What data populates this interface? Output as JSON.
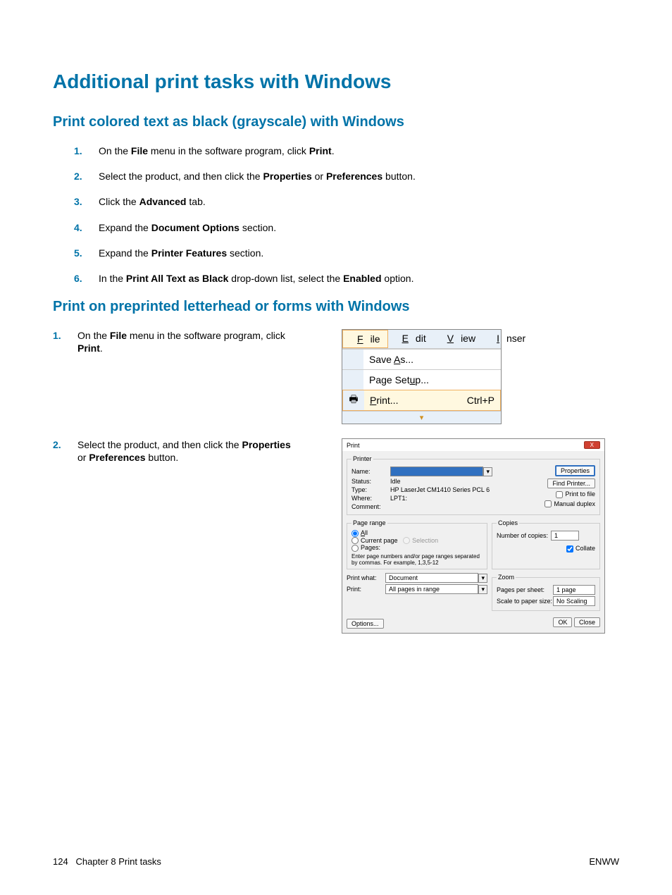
{
  "title": "Additional print tasks with Windows",
  "section1": {
    "heading": "Print colored text as black (grayscale) with Windows",
    "steps": [
      {
        "pre": "On the ",
        "b1": "File",
        "mid1": " menu in the software program, click ",
        "b2": "Print",
        "post": "."
      },
      {
        "pre": "Select the product, and then click the ",
        "b1": "Properties",
        "mid1": " or ",
        "b2": "Preferences",
        "post": " button."
      },
      {
        "pre": "Click the ",
        "b1": "Advanced",
        "post": " tab."
      },
      {
        "pre": "Expand the ",
        "b1": "Document Options",
        "post": " section."
      },
      {
        "pre": "Expand the ",
        "b1": "Printer Features",
        "post": " section."
      },
      {
        "pre": "In the ",
        "b1": "Print All Text as Black",
        "mid1": " drop-down list, select the ",
        "b2": "Enabled",
        "post": " option."
      }
    ]
  },
  "section2": {
    "heading": "Print on preprinted letterhead or forms with Windows",
    "step1": {
      "pre": "On the ",
      "b1": "File",
      "mid1": " menu in the software program, click ",
      "b2": "Print",
      "post": "."
    },
    "step2": {
      "pre": "Select the product, and then click the ",
      "b1": "Properties",
      "mid1": " or ",
      "b2": "Preferences",
      "post": " button."
    }
  },
  "menushot": {
    "menus": [
      "File",
      "Edit",
      "View",
      "Inser"
    ],
    "items": [
      {
        "label": "Save As..."
      },
      {
        "label": "Page Setup..."
      },
      {
        "label": "Print...",
        "shortcut": "Ctrl+P",
        "icon": "printer"
      }
    ]
  },
  "printdlg": {
    "title": "Print",
    "printer_legend": "Printer",
    "name_label": "Name:",
    "status_label": "Status:",
    "status_value": "Idle",
    "type_label": "Type:",
    "type_value": "HP LaserJet CM1410 Series PCL 6",
    "where_label": "Where:",
    "where_value": "LPT1:",
    "comment_label": "Comment:",
    "properties_btn": "Properties",
    "findprinter_btn": "Find Printer...",
    "printtofile": "Print to file",
    "manualduplex": "Manual duplex",
    "pagerange_legend": "Page range",
    "all": "All",
    "currentpage": "Current page",
    "selection": "Selection",
    "pages": "Pages:",
    "pages_hint": "Enter page numbers and/or page ranges separated by commas. For example, 1,3,5-12",
    "copies_legend": "Copies",
    "numcopies": "Number of copies:",
    "numcopies_val": "1",
    "collate": "Collate",
    "printwhat_label": "Print what:",
    "printwhat_val": "Document",
    "print_label": "Print:",
    "print_val": "All pages in range",
    "zoom_legend": "Zoom",
    "pps_label": "Pages per sheet:",
    "pps_val": "1 page",
    "scale_label": "Scale to paper size:",
    "scale_val": "No Scaling",
    "options_btn": "Options...",
    "ok_btn": "OK",
    "close_btn": "Close"
  },
  "footer": {
    "page": "124",
    "chapter": "Chapter 8   Print tasks",
    "right": "ENWW"
  }
}
